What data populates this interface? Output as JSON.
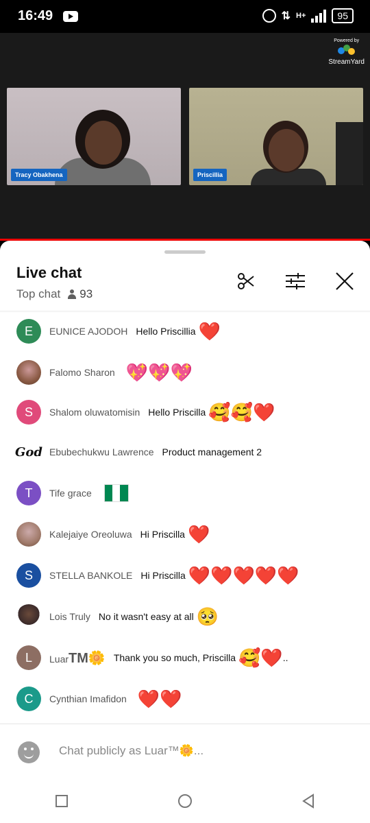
{
  "status_bar": {
    "time": "16:49",
    "battery": "95",
    "network": "H+"
  },
  "stream": {
    "powered_by": "Powered by",
    "brand": "StreamYard",
    "participants": [
      {
        "name": "Tracy Obakhena"
      },
      {
        "name": "Priscillia"
      }
    ]
  },
  "chat": {
    "title": "Live chat",
    "mode": "Top chat",
    "viewer_count": "93",
    "messages": [
      {
        "author": "EUNICE AJODOH",
        "text": "Hello Priscillia",
        "emoji": "❤️",
        "avatar": {
          "type": "letter",
          "letter": "E",
          "color": "#2e8b57"
        }
      },
      {
        "author": "Falomo Sharon",
        "text": "",
        "emoji": "💖💖💖",
        "avatar": {
          "type": "photo",
          "color": "#8a5a44"
        }
      },
      {
        "author": "Shalom oluwatomisin",
        "text": "Hello Priscilla",
        "emoji": "🥰🥰❤️",
        "avatar": {
          "type": "letter",
          "letter": "S",
          "color": "#e04a7a"
        }
      },
      {
        "author": "Ebubechukwu Lawrence",
        "text": "Product management 2",
        "emoji": "",
        "avatar": {
          "type": "logo",
          "letter": "God"
        }
      },
      {
        "author": "Tife grace",
        "text": "",
        "emoji": "🇳🇬",
        "avatar": {
          "type": "letter",
          "letter": "T",
          "color": "#7b4fc4"
        }
      },
      {
        "author": "Kalejaiye Oreoluwa",
        "text": "Hi Priscilla",
        "emoji": "❤️",
        "avatar": {
          "type": "photo",
          "color": "#a07a6a"
        }
      },
      {
        "author": "STELLA BANKOLE",
        "text": "Hi Priscilla",
        "emoji": "❤️❤️❤️❤️❤️",
        "avatar": {
          "type": "letter",
          "letter": "S",
          "color": "#1a4fa0"
        }
      },
      {
        "author": "Lois Truly",
        "text": "No it wasn't easy at all",
        "emoji": "🥺",
        "avatar": {
          "type": "photo",
          "color": "#3a2a2a"
        }
      },
      {
        "author": "Luar",
        "author_suffix": "TM🌼",
        "text": "Thank you so much, Priscilla",
        "emoji": "🥰❤️",
        "trailing": "..",
        "avatar": {
          "type": "letter",
          "letter": "L",
          "color": "#8d6e63"
        }
      },
      {
        "author": "Cynthian Imafidon",
        "text": "",
        "emoji": "❤️❤️",
        "avatar": {
          "type": "letter",
          "letter": "C",
          "color": "#1b9a8a"
        }
      }
    ],
    "input_placeholder": "Chat publicly as Luar™🌼..."
  },
  "icons": {
    "clip": "scissors-icon",
    "filter": "sliders-icon",
    "close": "close-icon",
    "viewers": "person-icon",
    "user_avatar": "face-icon",
    "nav": [
      "square-recents-icon",
      "circle-home-icon",
      "triangle-back-icon"
    ]
  },
  "colors": {
    "accent": "#e00000",
    "name_tag": "#1565c0"
  }
}
